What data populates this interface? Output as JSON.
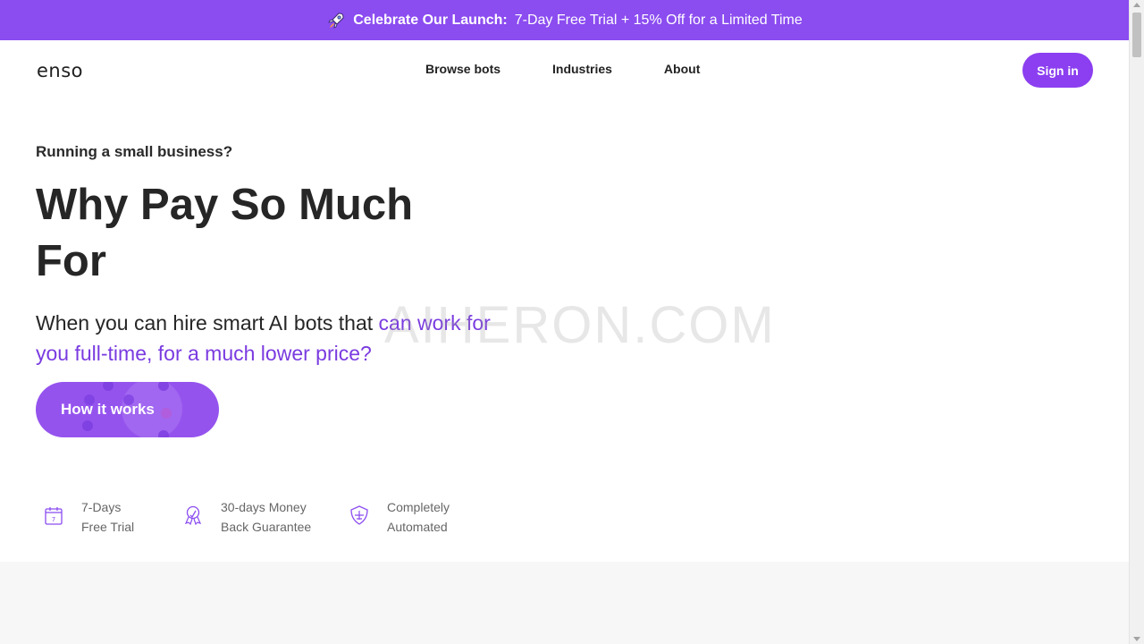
{
  "promo": {
    "icon": "rocket-icon",
    "strong": "Celebrate Our Launch:",
    "rest": "7-Day Free Trial + 15% Off for a Limited Time"
  },
  "header": {
    "logo": "enso",
    "nav": [
      "Browse bots",
      "Industries",
      "About"
    ],
    "signin": "Sign in"
  },
  "hero": {
    "eyebrow": "Running a small business?",
    "headline": "Why Pay So Much For",
    "subhead_plain": "When you can hire smart AI bots that ",
    "subhead_accent": "can work for you full-time, for a much lower price?",
    "cta": "How it works"
  },
  "features": [
    {
      "icon": "calendar-icon",
      "line1": "7-Days",
      "line2": "Free Trial"
    },
    {
      "icon": "award-ribbon-icon",
      "line1": "30-days Money",
      "line2": "Back Guarantee"
    },
    {
      "icon": "shield-plane-icon",
      "line1": "Completely",
      "line2": "Automated"
    }
  ],
  "watermark": "AIHERON.COM",
  "colors": {
    "brand": "#8b3ff0",
    "promo_bg": "#8b4cf0",
    "accent_text": "#7a3be0",
    "section_gray": "#f7f7f8"
  }
}
